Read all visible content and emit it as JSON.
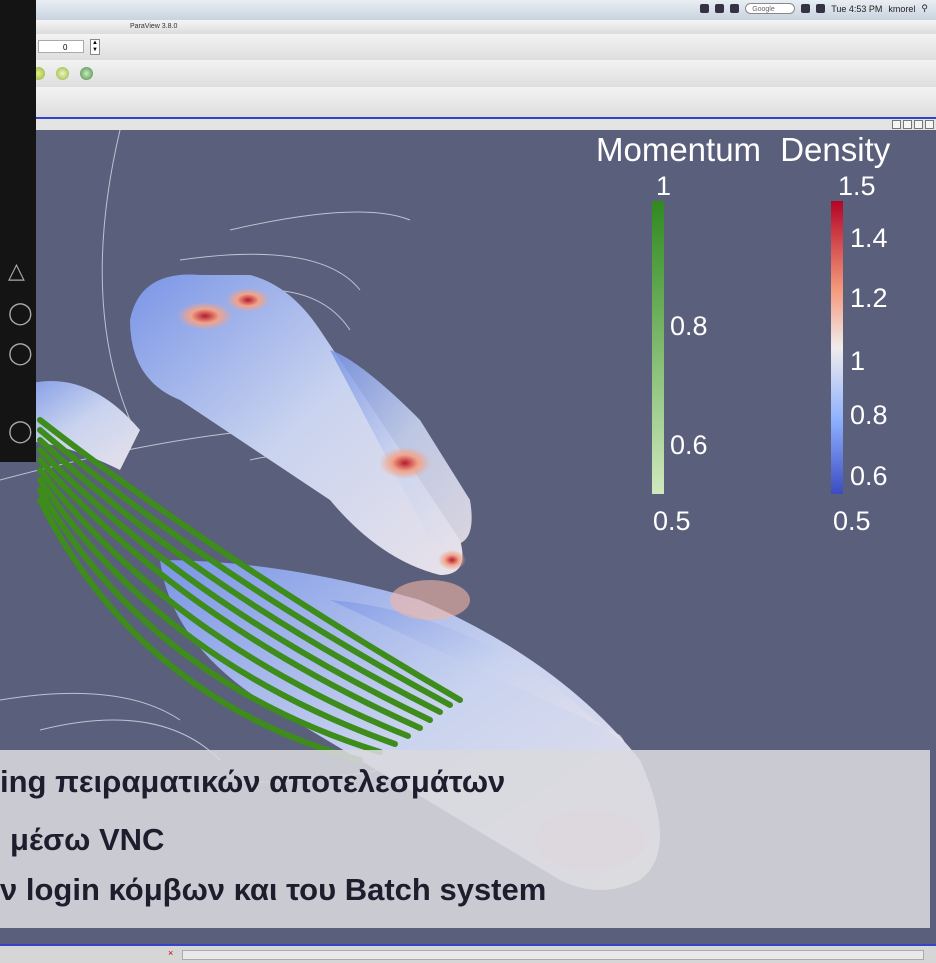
{
  "menubar": {
    "app_title": "ParaView 3.8.0",
    "clock": "Tue 4:53 PM",
    "user": "kmorel",
    "search_placeholder": "Google"
  },
  "toolbar": {
    "time_value": "0"
  },
  "legend": {
    "title": "Momentum  Density",
    "momentum_ticks": [
      "1",
      "0.8",
      "0.6",
      "0.5"
    ],
    "density_ticks": [
      "1.5",
      "1.4",
      "1.2",
      "1",
      "0.8",
      "0.6",
      "0.5"
    ],
    "momentum_colors": [
      "#2f8a1f",
      "#cfe9bd"
    ],
    "density_colors": [
      "#b40426",
      "#f0ecec",
      "#3b4cc0"
    ]
  },
  "caption": {
    "line1": "ing πειραματικών αποτελεσμάτων",
    "line2": "μέσω VNC",
    "line3": "ν login κόμβων και του Batch system"
  },
  "colors": {
    "background": "#5a5f7b",
    "streamlines": "#3d8c1c"
  }
}
